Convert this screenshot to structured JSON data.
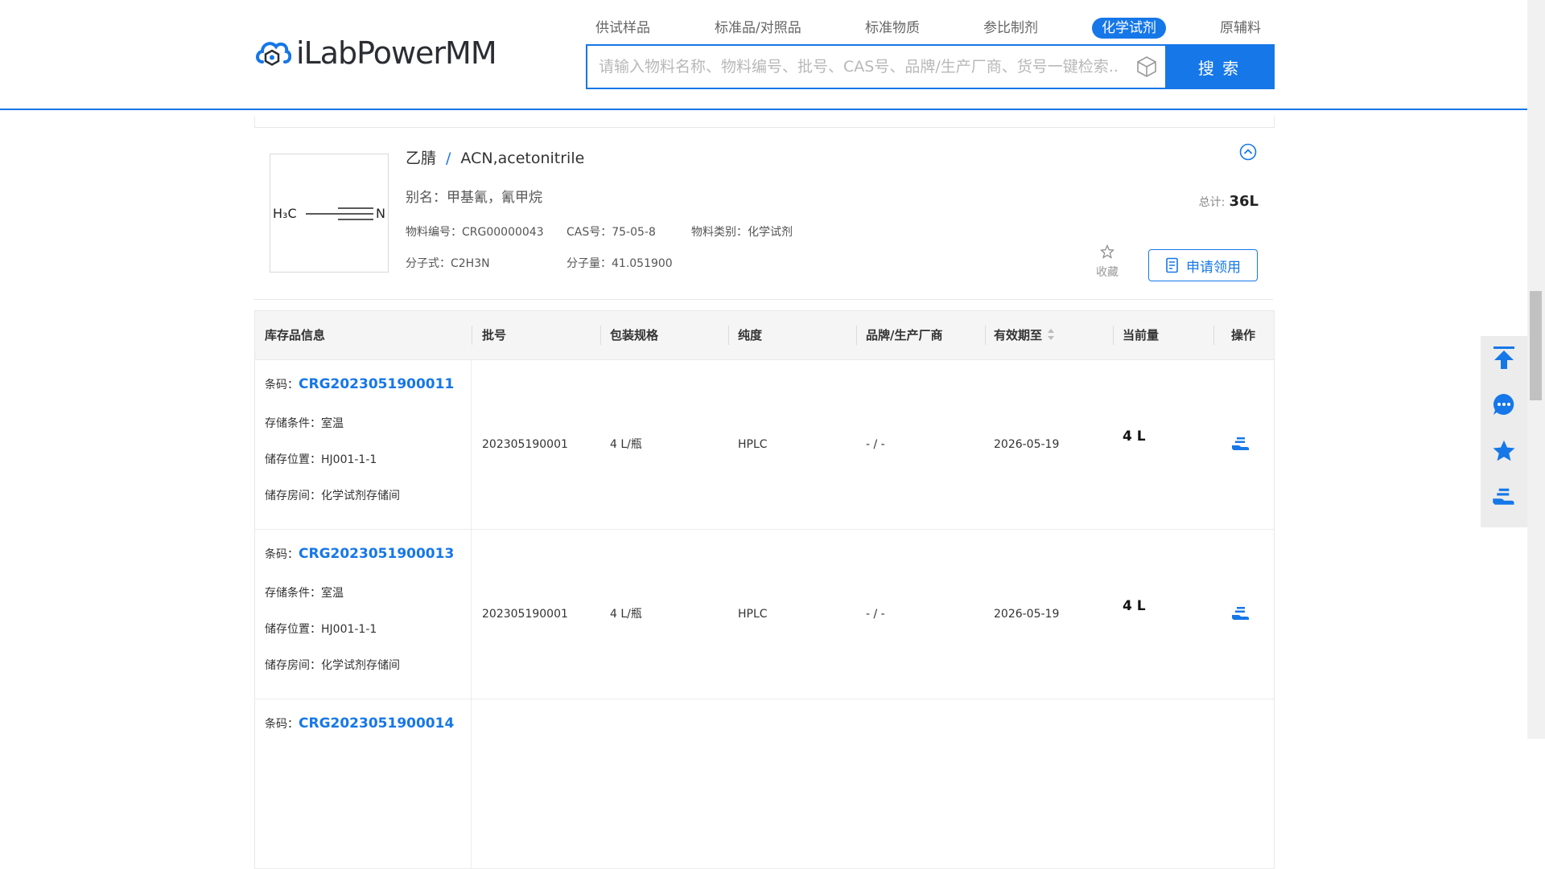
{
  "brand": {
    "logo_text": "iLabPowerMM"
  },
  "nav": {
    "items": [
      {
        "label": "供试样品"
      },
      {
        "label": "标准品/对照品"
      },
      {
        "label": "标准物质"
      },
      {
        "label": "参比制剂"
      },
      {
        "label": "化学试剂",
        "active": true
      },
      {
        "label": "原辅料"
      }
    ]
  },
  "search": {
    "placeholder": "请输入物料名称、物料编号、批号、CAS号、品牌/生产厂商、货号一键检索...",
    "button_label": "搜 索"
  },
  "product": {
    "name_cn": "乙腈",
    "separator": "/",
    "name_en": "ACN,acetonitrile",
    "alias": "别名：甲基氰，氰甲烷",
    "material_code": "物料编号：CRG00000043",
    "cas": "CAS号：75-05-8",
    "category": "物料类别：化学试剂",
    "formula": "分子式：C2H3N",
    "weight": "分子量：41.051900",
    "total_label": "总计:",
    "total_value": "36L",
    "favorite_label": "收藏",
    "apply_label": "申请领用",
    "structure": {
      "left": "H₃C",
      "right": "N"
    }
  },
  "table": {
    "headers": [
      "库存品信息",
      "批号",
      "包装规格",
      "纯度",
      "品牌/生产厂商",
      "有效期至",
      "当前量",
      "操作"
    ],
    "rows": [
      {
        "barcode_label": "条码：",
        "barcode": "CRG2023051900011",
        "storage_condition": "存储条件：室温",
        "storage_location": "储存位置：HJ001-1-1",
        "storage_room": "储存房间：化学试剂存储间",
        "batch": "202305190001",
        "package": "4 L/瓶",
        "purity": "HPLC",
        "brand": "- / -",
        "expiry": "2026-05-19",
        "quantity": "4 L"
      },
      {
        "barcode_label": "条码：",
        "barcode": "CRG2023051900013",
        "storage_condition": "存储条件：室温",
        "storage_location": "储存位置：HJ001-1-1",
        "storage_room": "储存房间：化学试剂存储间",
        "batch": "202305190001",
        "package": "4 L/瓶",
        "purity": "HPLC",
        "brand": "- / -",
        "expiry": "2026-05-19",
        "quantity": "4 L"
      },
      {
        "barcode_label": "条码：",
        "barcode": "CRG2023051900014"
      }
    ]
  },
  "toolbar": {
    "icons": [
      "back-to-top-icon",
      "chat-icon",
      "star-icon",
      "hand-receive-icon"
    ]
  },
  "colors": {
    "accent": "#1677e8",
    "header_bg": "#f5f5f5",
    "toolbar_bg": "#ececec"
  }
}
